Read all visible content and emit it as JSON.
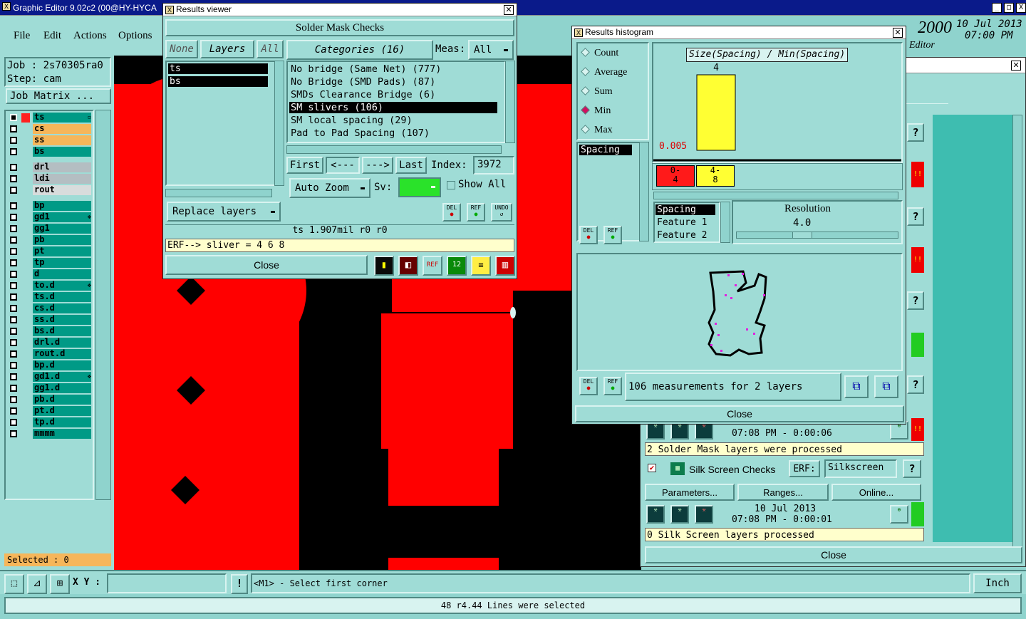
{
  "main": {
    "title": "Graphic Editor 9.02c2 (00@HY-HYCA",
    "menu": [
      "File",
      "Edit",
      "Actions",
      "Options"
    ],
    "job_label": "Job : 2s70305ra0",
    "step_label": "Step: cam",
    "job_matrix": "Job Matrix ...",
    "layers": [
      {
        "name": "ts",
        "color": "#009a86",
        "mark": "▫"
      },
      {
        "name": "cs",
        "color": "#f6b65a"
      },
      {
        "name": "ss",
        "color": "#f6b65a"
      },
      {
        "name": "bs",
        "color": "#009a86"
      },
      {
        "name": "drl",
        "color": "#b4bec2"
      },
      {
        "name": "ldi",
        "color": "#b4bec2"
      },
      {
        "name": "rout",
        "color": "#d8dcdc"
      },
      {
        "name": "bp",
        "color": "#009a86"
      },
      {
        "name": "gd1",
        "color": "#009a86",
        "mark": "❖"
      },
      {
        "name": "gg1",
        "color": "#009a86"
      },
      {
        "name": "pb",
        "color": "#009a86"
      },
      {
        "name": "pt",
        "color": "#009a86"
      },
      {
        "name": "tp",
        "color": "#009a86"
      },
      {
        "name": "d",
        "color": "#009a86"
      },
      {
        "name": "to.d",
        "color": "#009a86",
        "mark": "❖"
      },
      {
        "name": "ts.d",
        "color": "#009a86"
      },
      {
        "name": "cs.d",
        "color": "#009a86"
      },
      {
        "name": "ss.d",
        "color": "#009a86"
      },
      {
        "name": "bs.d",
        "color": "#009a86"
      },
      {
        "name": "drl.d",
        "color": "#009a86"
      },
      {
        "name": "rout.d",
        "color": "#009a86"
      },
      {
        "name": "bp.d",
        "color": "#009a86"
      },
      {
        "name": "gd1.d",
        "color": "#009a86",
        "mark": "❖"
      },
      {
        "name": "gg1.d",
        "color": "#009a86"
      },
      {
        "name": "pb.d",
        "color": "#009a86"
      },
      {
        "name": "pt.d",
        "color": "#009a86"
      },
      {
        "name": "tp.d",
        "color": "#009a86"
      },
      {
        "name": "mmmm",
        "color": "#009a86"
      }
    ],
    "selected": "Selected : 0",
    "xy_label": "X Y :",
    "xy_value": "",
    "hint": "<M1> - Select first corner",
    "units": "Inch",
    "status": "48 r4.44 Lines were selected",
    "brand_number": "2000",
    "brand_editor": "Editor",
    "date": "10 Jul 2013",
    "time": "07:00 PM",
    "window_controls": [
      "_",
      "□",
      "X"
    ]
  },
  "results_viewer": {
    "title": "Results viewer",
    "heading": "Solder Mask Checks",
    "tabs": [
      "None",
      "Layers",
      "All"
    ],
    "layers": [
      "ts",
      "bs"
    ],
    "categories_btn": "Categories (16)",
    "meas_label": "Meas:",
    "meas_value": "All",
    "categories": [
      "No bridge (Same Net) (777)",
      "No Bridge (SMD Pads) (87)",
      "SMDs Clearance Bridge (6)",
      "SM slivers (106)",
      "SM local spacing (29)",
      "Pad to Pad Spacing (107)"
    ],
    "selected_category": 3,
    "nav": [
      "First",
      "<---",
      "--->",
      "Last"
    ],
    "index_label": "Index:",
    "index_value": "3972",
    "auto_zoom": "Auto Zoom",
    "sv_label": "Sv:",
    "show_all": "Show All",
    "replace_layers": "Replace layers",
    "small_buttons": [
      "DEL",
      "REF",
      "UNDO"
    ],
    "info_line": "ts 1.907mil  r0  r0",
    "erf_line": "ERF--> sliver = 4 6 8",
    "close": "Close"
  },
  "histogram": {
    "title": "Results histogram",
    "modes": [
      "Count",
      "Average",
      "Sum",
      "Min",
      "Max"
    ],
    "selected_mode": "Min",
    "chart_title": "Size(Spacing) / Min(Spacing)",
    "bar_label": "4",
    "min_value": "0.005",
    "bins": [
      {
        "label": "0-\n4",
        "color": "#ff1a1a"
      },
      {
        "label": "4-\n8",
        "color": "#ffff33"
      }
    ],
    "list_item": "Spacing",
    "features": [
      "Spacing",
      "Feature 1",
      "Feature 2"
    ],
    "resolution_label": "Resolution",
    "resolution_value": "4.0",
    "measurements": "106 measurements for 2 layers",
    "close": "Close",
    "small_buttons": [
      "DEL",
      "REF"
    ],
    "chart_data": {
      "type": "bar",
      "categories": [
        "0-4",
        "4-8"
      ],
      "values": [
        0,
        4
      ],
      "title": "Size(Spacing) / Min(Spacing)",
      "colors": [
        "#ff1a1a",
        "#ffff33"
      ]
    }
  },
  "checklist": {
    "time_stamp_1": "07:08 PM - 0:00:06",
    "status_1": "2 Solder Mask layers were processed",
    "check_name": "Silk Screen Checks",
    "erf_label": "ERF:",
    "erf_value": "Silkscreen",
    "help": "?",
    "parameters": "Parameters...",
    "ranges": "Ranges...",
    "online": "Online...",
    "date_2": "10 Jul 2013",
    "time_stamp_2": "07:08 PM - 0:00:01",
    "status_2": "0 Silk Screen layers processed",
    "close": "Close",
    "alert": "!!"
  }
}
